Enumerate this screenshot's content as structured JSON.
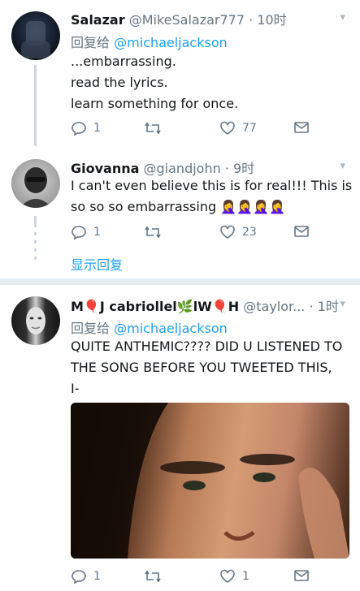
{
  "tweets": [
    {
      "name": "Salazar",
      "handle": "@MikeSalazar777",
      "time": "· 10时",
      "reply_prefix": "回复给",
      "reply_to": "@michaeljackson",
      "lines": [
        "...embarrassing.",
        "read the lyrics.",
        "learn something for once."
      ],
      "replies": "1",
      "retweets": "",
      "likes": "77"
    },
    {
      "name": "Giovanna",
      "handle": "@giandjohn",
      "time": "· 9时",
      "lines": [
        "I can't even believe this is for real!!! This is",
        "so so so embarrassing 🤦‍♀️🤦‍♀️🤦‍♀️🤦‍♀️"
      ],
      "replies": "1",
      "retweets": "",
      "likes": "23",
      "show_replies": "显示回复"
    },
    {
      "name": "M🎈J cabriollel🌿lW🎈H",
      "handle": "@taylor...",
      "time": "· 1时",
      "reply_prefix": "回复给",
      "reply_to": "@michaeljackson",
      "lines": [
        "QUITE ANTHEMIC???? DID U LISTENED TO",
        "THE SONG BEFORE YOU TWEETED THIS,",
        "I-"
      ],
      "replies": "1",
      "retweets": "",
      "likes": "1"
    }
  ],
  "colors": {
    "accent": "#1da1f2",
    "muted": "#657786",
    "divider": "#e6ecf0"
  },
  "icons": [
    "reply-icon",
    "retweet-icon",
    "like-icon",
    "dm-icon",
    "chevron-down-icon"
  ]
}
